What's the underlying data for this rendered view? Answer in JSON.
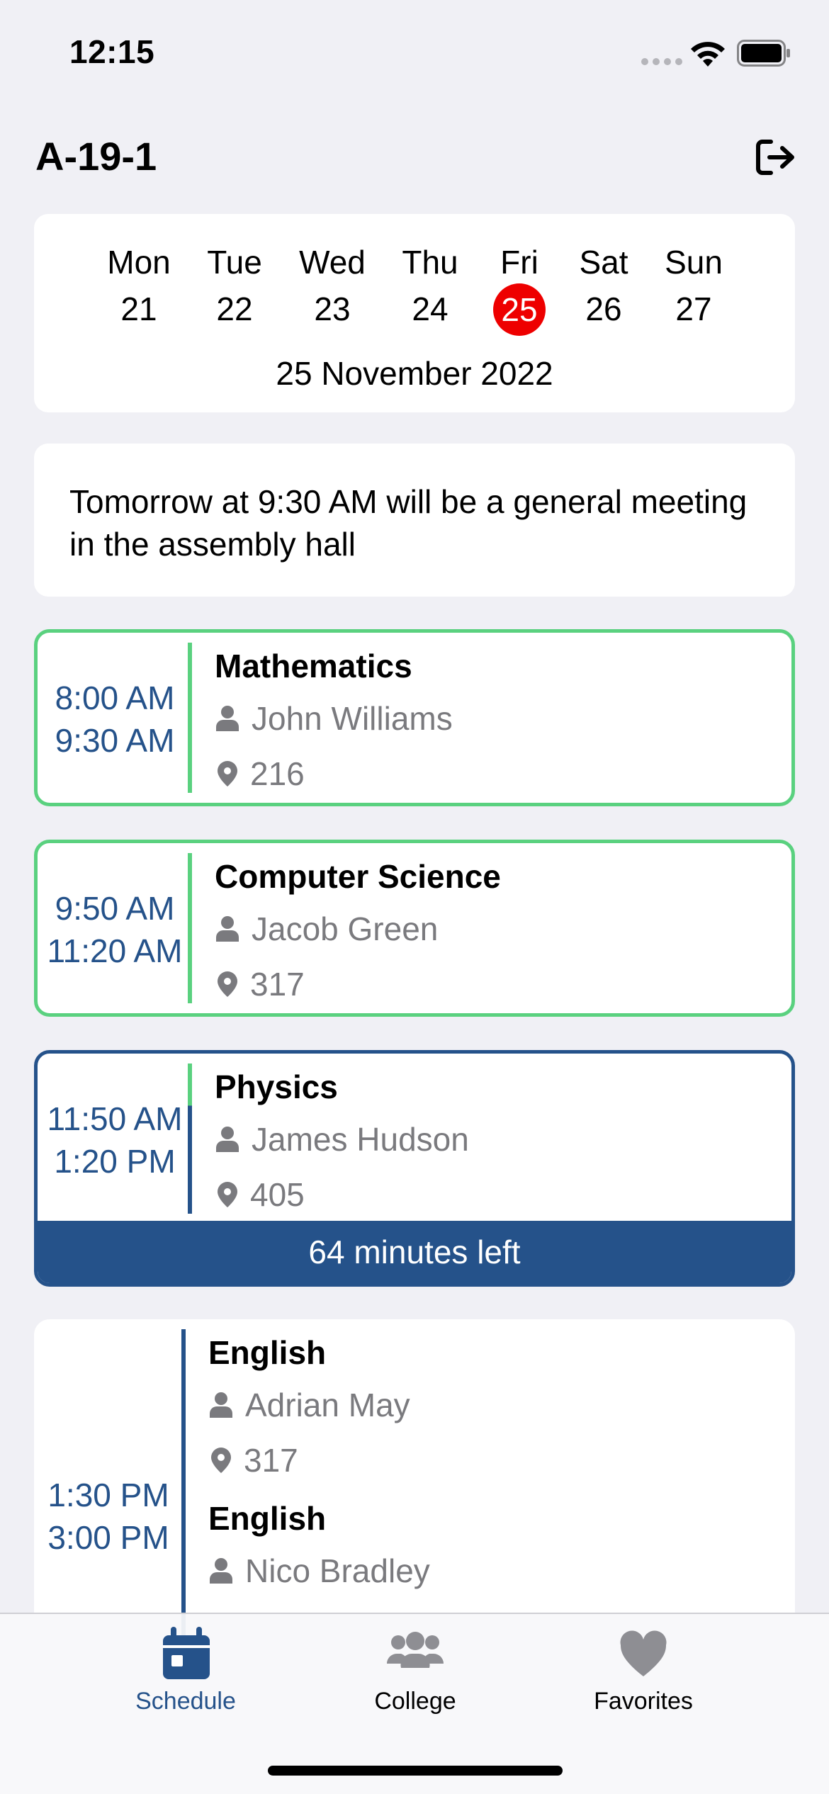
{
  "status_bar": {
    "time": "12:15"
  },
  "header": {
    "title": "A-19-1"
  },
  "week": {
    "days": [
      {
        "name": "Mon",
        "num": "21"
      },
      {
        "name": "Tue",
        "num": "22"
      },
      {
        "name": "Wed",
        "num": "23"
      },
      {
        "name": "Thu",
        "num": "24"
      },
      {
        "name": "Fri",
        "num": "25"
      },
      {
        "name": "Sat",
        "num": "26"
      },
      {
        "name": "Sun",
        "num": "27"
      }
    ],
    "selected_index": 4,
    "full_date": "25 November 2022"
  },
  "notice": {
    "text": "Tomorrow at 9:30 AM will be a general meeting in the assembly hall"
  },
  "lessons": [
    {
      "start": "8:00 AM",
      "end": "9:30 AM",
      "subject": "Mathematics",
      "teacher": "John Williams",
      "room": "216"
    },
    {
      "start": "9:50 AM",
      "end": "11:20 AM",
      "subject": "Computer Science",
      "teacher": "Jacob Green",
      "room": "317"
    },
    {
      "start": "11:50 AM",
      "end": "1:20 PM",
      "subject": "Physics",
      "teacher": "James Hudson",
      "room": "405",
      "remaining": "64 minutes left"
    },
    {
      "start": "1:30 PM",
      "end": "3:00 PM",
      "entries": [
        {
          "subject": "English",
          "teacher": "Adrian May",
          "room": "317"
        },
        {
          "subject": "English",
          "teacher": "Nico Bradley"
        }
      ]
    }
  ],
  "tabbar": {
    "tabs": [
      {
        "label": "Schedule",
        "icon": "calendar-icon"
      },
      {
        "label": "College",
        "icon": "people-icon"
      },
      {
        "label": "Favorites",
        "icon": "heart-icon"
      }
    ],
    "active": 0
  },
  "colors": {
    "accent": "#25528a",
    "done_border": "#5ad17f",
    "selected_day": "#ee0000",
    "inactive_icon": "#8e8e93"
  }
}
